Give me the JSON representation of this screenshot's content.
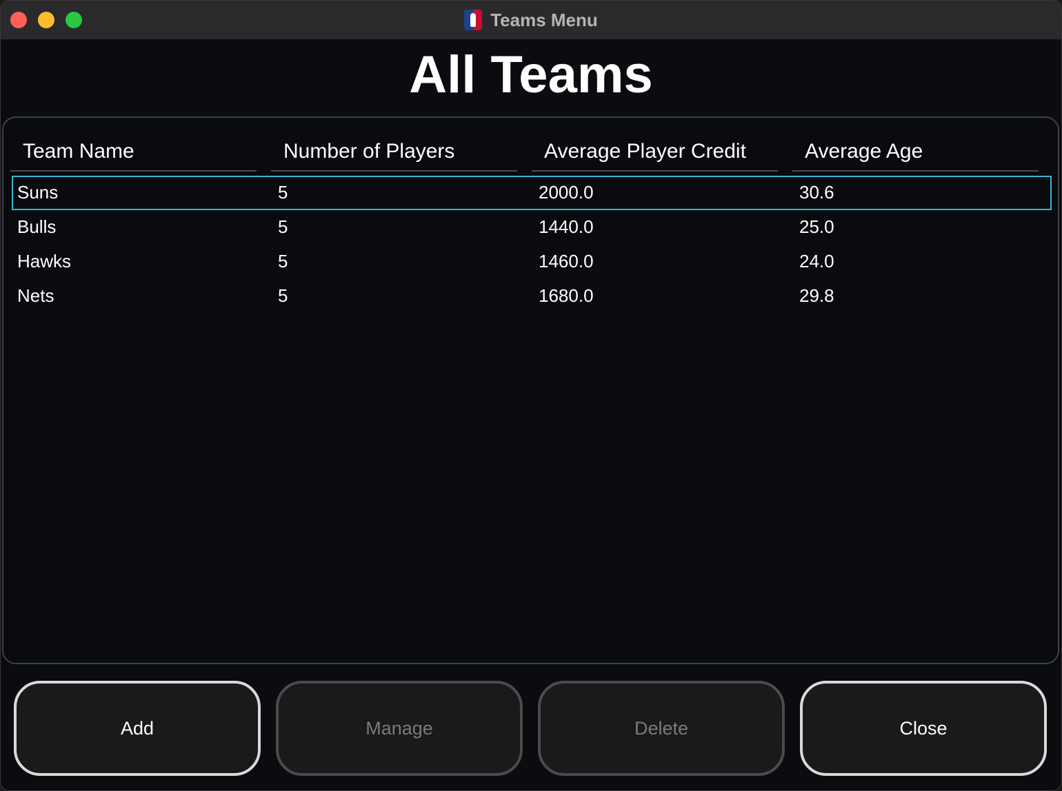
{
  "window": {
    "title": "Teams Menu",
    "app_icon": "nba-logo-icon"
  },
  "heading": "All Teams",
  "table": {
    "columns": [
      "Team Name",
      "Number of Players",
      "Average Player Credit",
      "Average Age"
    ],
    "selected_row": 0,
    "rows": [
      [
        "Suns",
        "5",
        "2000.0",
        "30.6"
      ],
      [
        "Bulls",
        "5",
        "1440.0",
        "25.0"
      ],
      [
        "Hawks",
        "5",
        "1460.0",
        "24.0"
      ],
      [
        "Nets",
        "5",
        "1680.0",
        "29.8"
      ]
    ]
  },
  "buttons": {
    "add": "Add",
    "manage": "Manage",
    "delete": "Delete",
    "close": "Close"
  },
  "colors": {
    "selection_outline": "#3db5d4",
    "background": "#0a0c0f"
  }
}
